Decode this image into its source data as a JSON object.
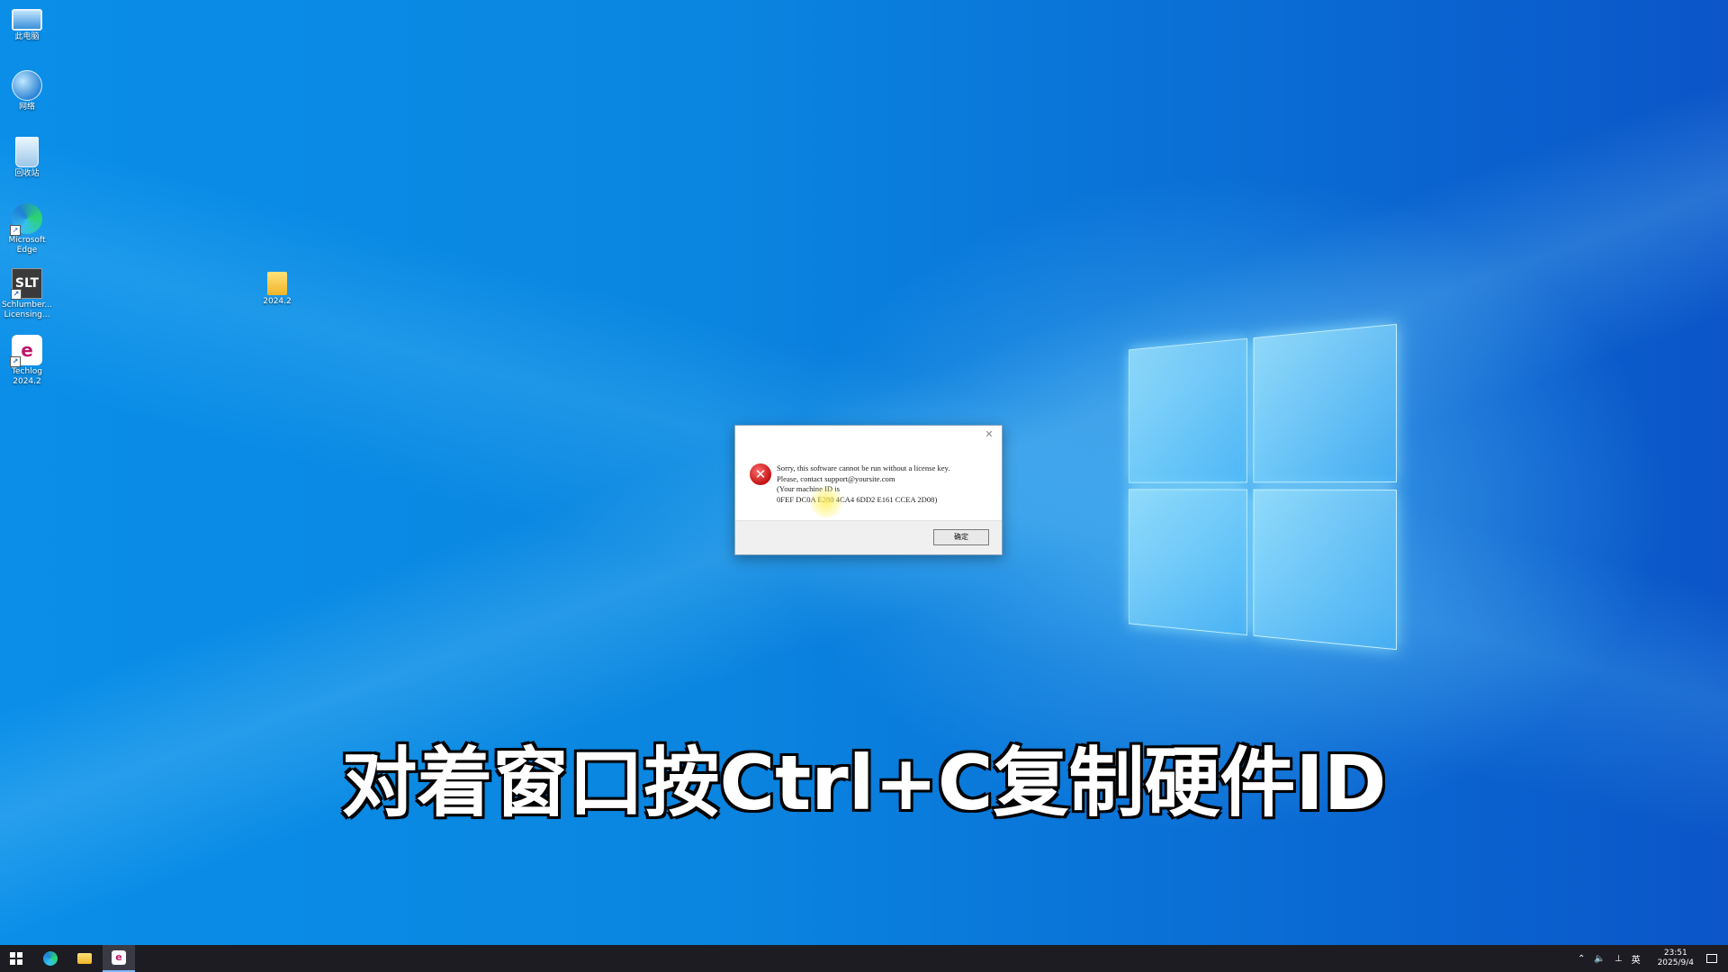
{
  "desktop": {
    "icons": [
      {
        "label": "此电脑",
        "icon": "computer-icon"
      },
      {
        "label": "网络",
        "icon": "network-icon"
      },
      {
        "label": "回收站",
        "icon": "recycle-bin-icon"
      },
      {
        "label": "Microsoft Edge",
        "icon": "edge-icon"
      },
      {
        "label": "Schlumber... Licensing...",
        "icon": "slt-icon",
        "glyph": "SLT"
      },
      {
        "label": "Techlog 2024.2",
        "icon": "techlog-icon",
        "glyph": "e"
      }
    ],
    "folder": {
      "label": "2024.2",
      "icon": "folder-icon"
    }
  },
  "dialog": {
    "close_glyph": "✕",
    "error_glyph": "✕",
    "lines": [
      "Sorry, this software cannot be run without a license key.",
      "Please, contact support@yoursite.com",
      "(Your machine ID is",
      "0FEF DC0A E280 4CA4 6DD2 E161 CCEA 2D08)"
    ],
    "ok_label": "确定"
  },
  "caption": "对着窗口按Ctrl+C复制硬件ID",
  "taskbar": {
    "tray": {
      "up_arrow": "⌃",
      "volume": "🔈",
      "network": "⊥",
      "language": "英",
      "time": "23:51",
      "date": "2025/9/4"
    }
  },
  "colors": {
    "desktop_blue": "#0a86e0",
    "taskbar": "#1c1c22",
    "error_red": "#c21212"
  }
}
